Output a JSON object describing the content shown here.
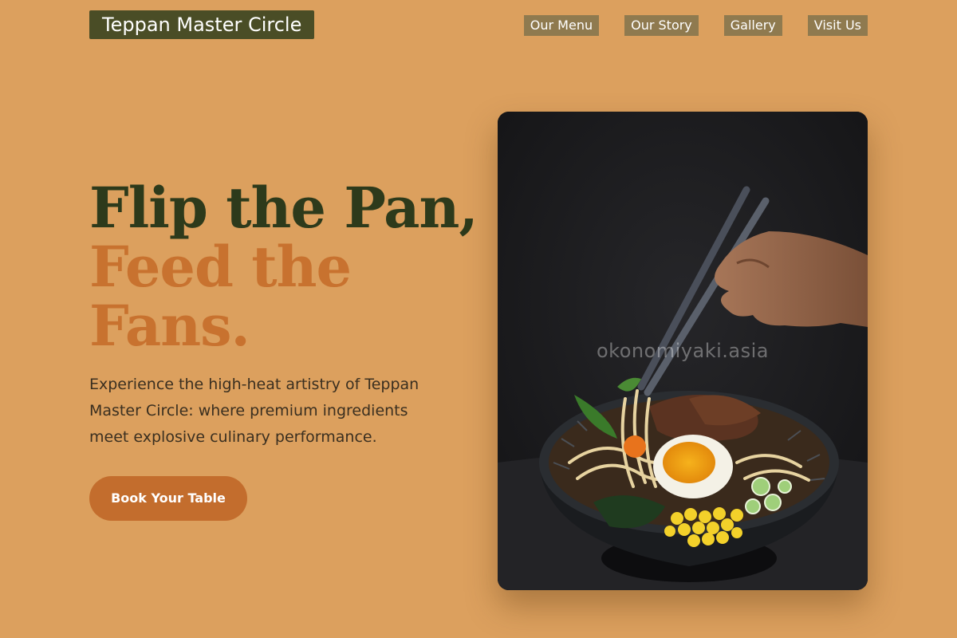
{
  "header": {
    "logo": "Teppan Master Circle",
    "nav": [
      {
        "label": "Our Menu"
      },
      {
        "label": "Our Story"
      },
      {
        "label": "Gallery"
      },
      {
        "label": "Visit Us"
      }
    ]
  },
  "hero": {
    "title_line1": "Flip the Pan,",
    "title_line2": "Feed the",
    "title_line3": "Fans.",
    "subtitle": "Experience the high-heat artistry of Teppan Master Circle: where premium ingredients meet explosive culinary performance.",
    "cta_label": "Book Your Table",
    "image_watermark": "okonomiyaki.asia"
  },
  "colors": {
    "background": "#dca05e",
    "logo_bg": "#4a4d26",
    "nav_bg": "#8f7a4f",
    "title_dark": "#2d3a1b",
    "title_accent": "#c8722f",
    "cta_bg": "#c36d2d"
  }
}
